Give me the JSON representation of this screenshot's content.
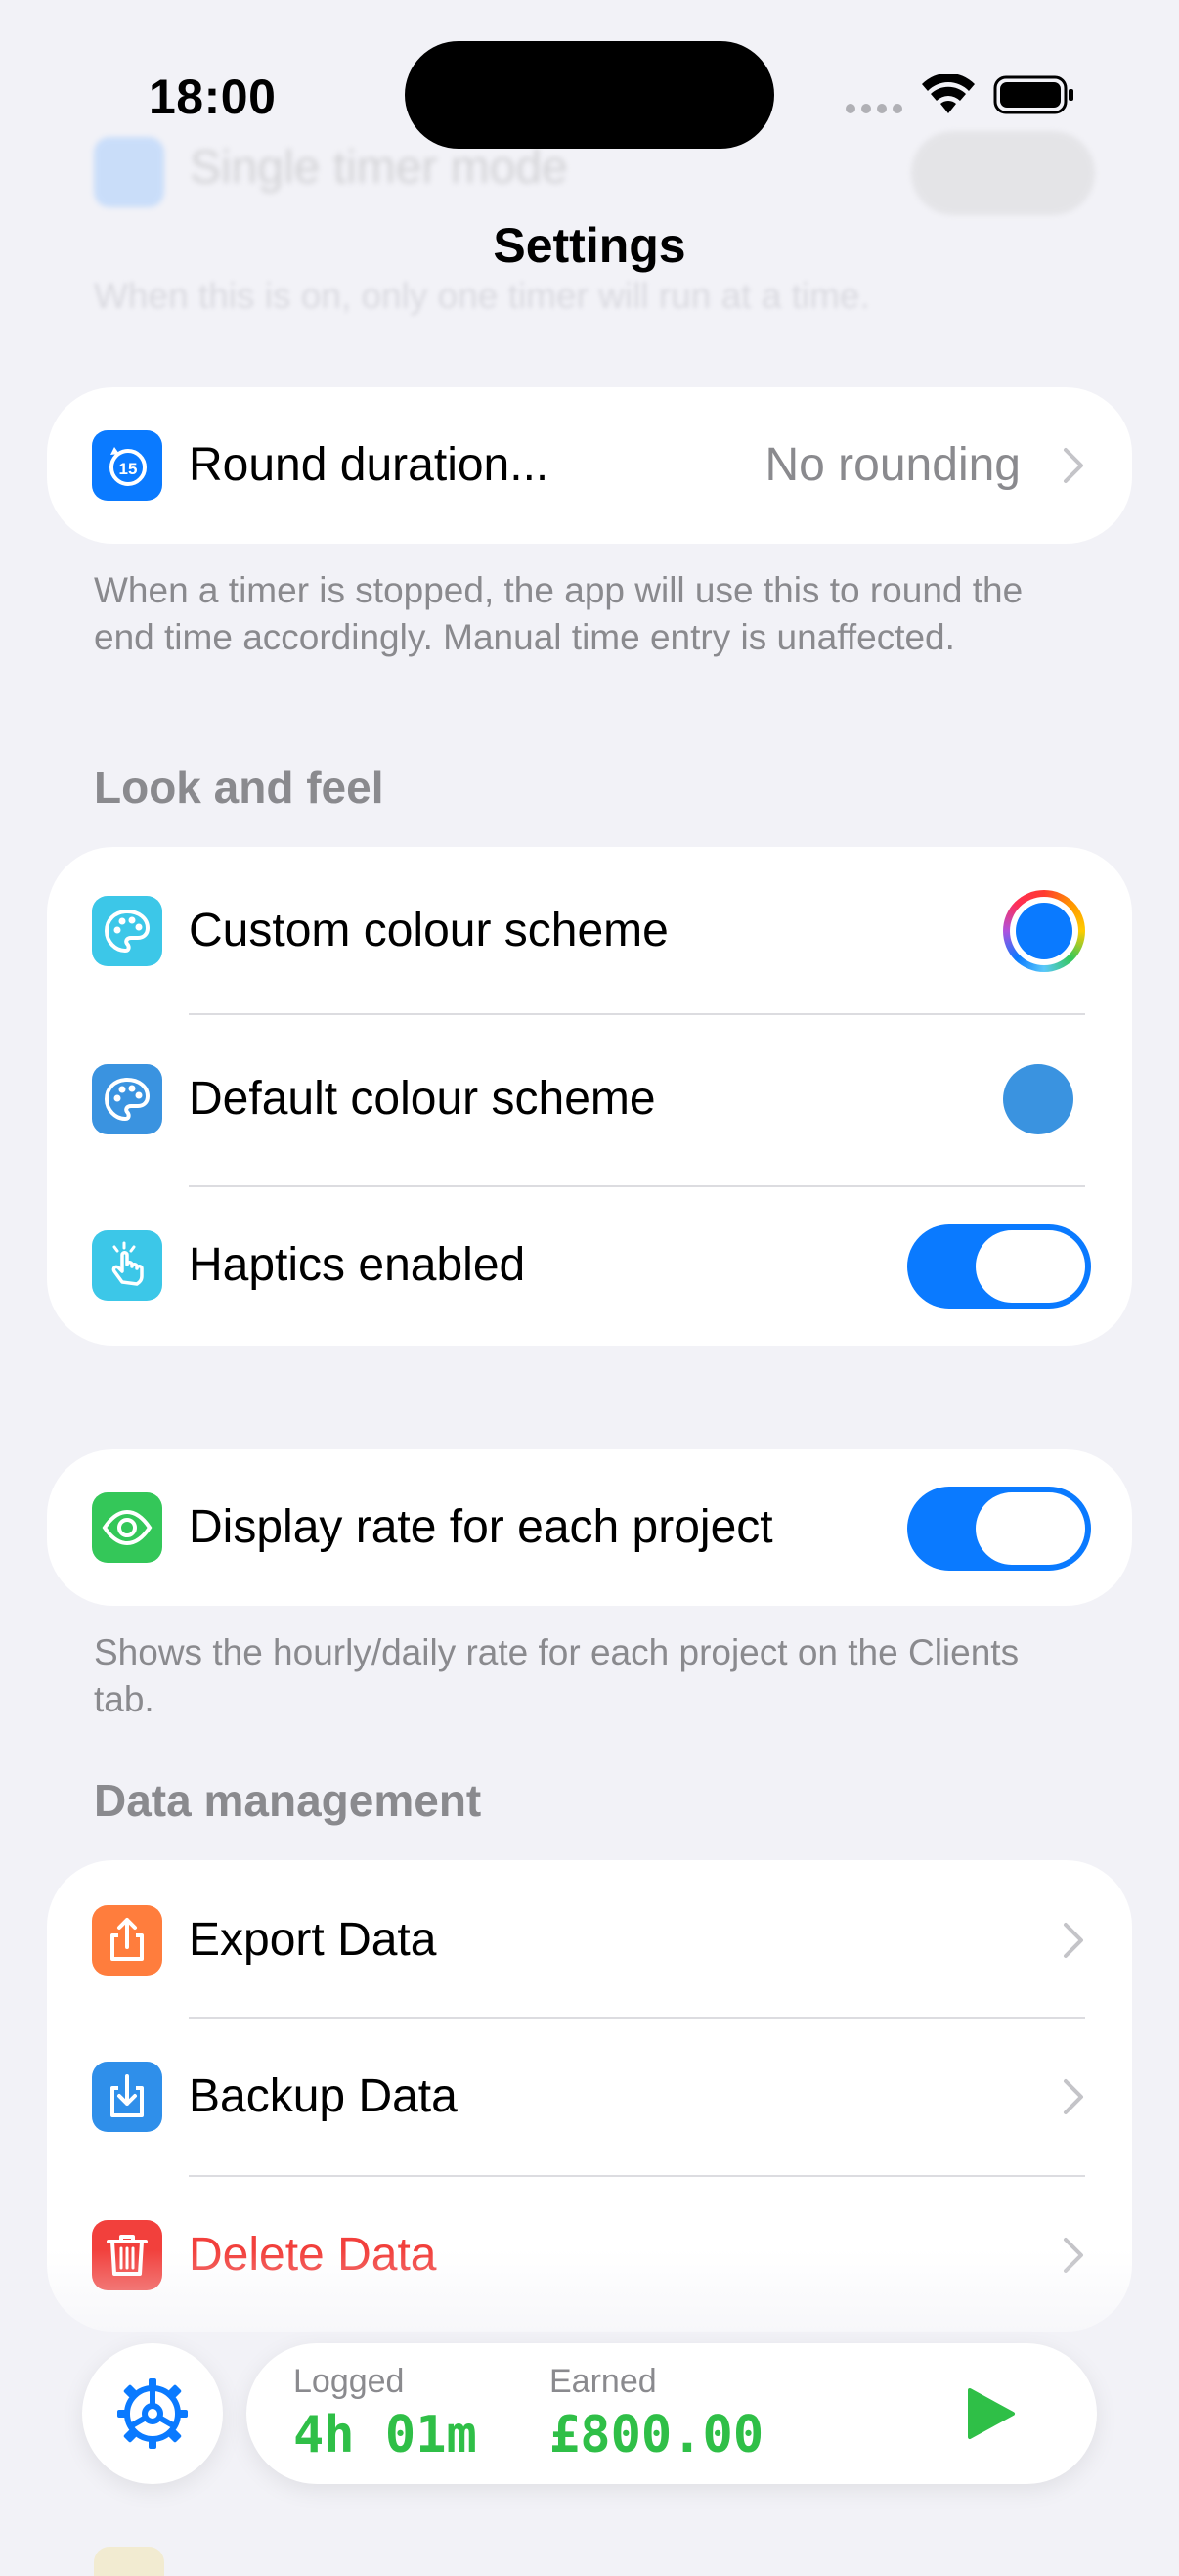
{
  "status_bar": {
    "time": "18:00"
  },
  "behind_content": {
    "single_timer_label": "Single timer mode",
    "single_timer_footnote": "When this is on, only one timer will run at a time."
  },
  "nav": {
    "title": "Settings"
  },
  "rounding": {
    "label": "Round duration...",
    "value": "No rounding",
    "footnote": "When a timer is stopped, the app will use this to round the end time accordingly. Manual time entry is unaffected.",
    "icon": "timer-15-icon"
  },
  "look_and_feel": {
    "header": "Look and feel",
    "items": [
      {
        "label": "Custom colour scheme",
        "icon": "palette-icon",
        "control": "colour-wheel"
      },
      {
        "label": "Default colour scheme",
        "icon": "palette-icon",
        "control": "colour-dot",
        "color": "#3a93e0"
      },
      {
        "label": "Haptics enabled",
        "icon": "tap-hand-icon",
        "control": "toggle",
        "on": true
      }
    ]
  },
  "display_rate": {
    "label": "Display rate for each project",
    "icon": "eye-icon",
    "on": true,
    "footnote": "Shows the hourly/daily rate for each project on the Clients tab."
  },
  "data_management": {
    "header": "Data management",
    "items": [
      {
        "label": "Export Data",
        "icon": "share-icon"
      },
      {
        "label": "Backup Data",
        "icon": "download-icon"
      },
      {
        "label": "Delete Data",
        "icon": "trash-icon",
        "destructive": true
      }
    ]
  },
  "bottom_bar": {
    "logged_label": "Logged",
    "logged_value": "4h 01m",
    "earned_label": "Earned",
    "earned_value": "£800.00",
    "settings_icon": "gear-icon",
    "play_icon": "play-icon"
  },
  "colors": {
    "accent": "#0a7aff",
    "destructive": "#f2403c",
    "money_green": "#2fbf47",
    "background": "#f2f2f7"
  }
}
